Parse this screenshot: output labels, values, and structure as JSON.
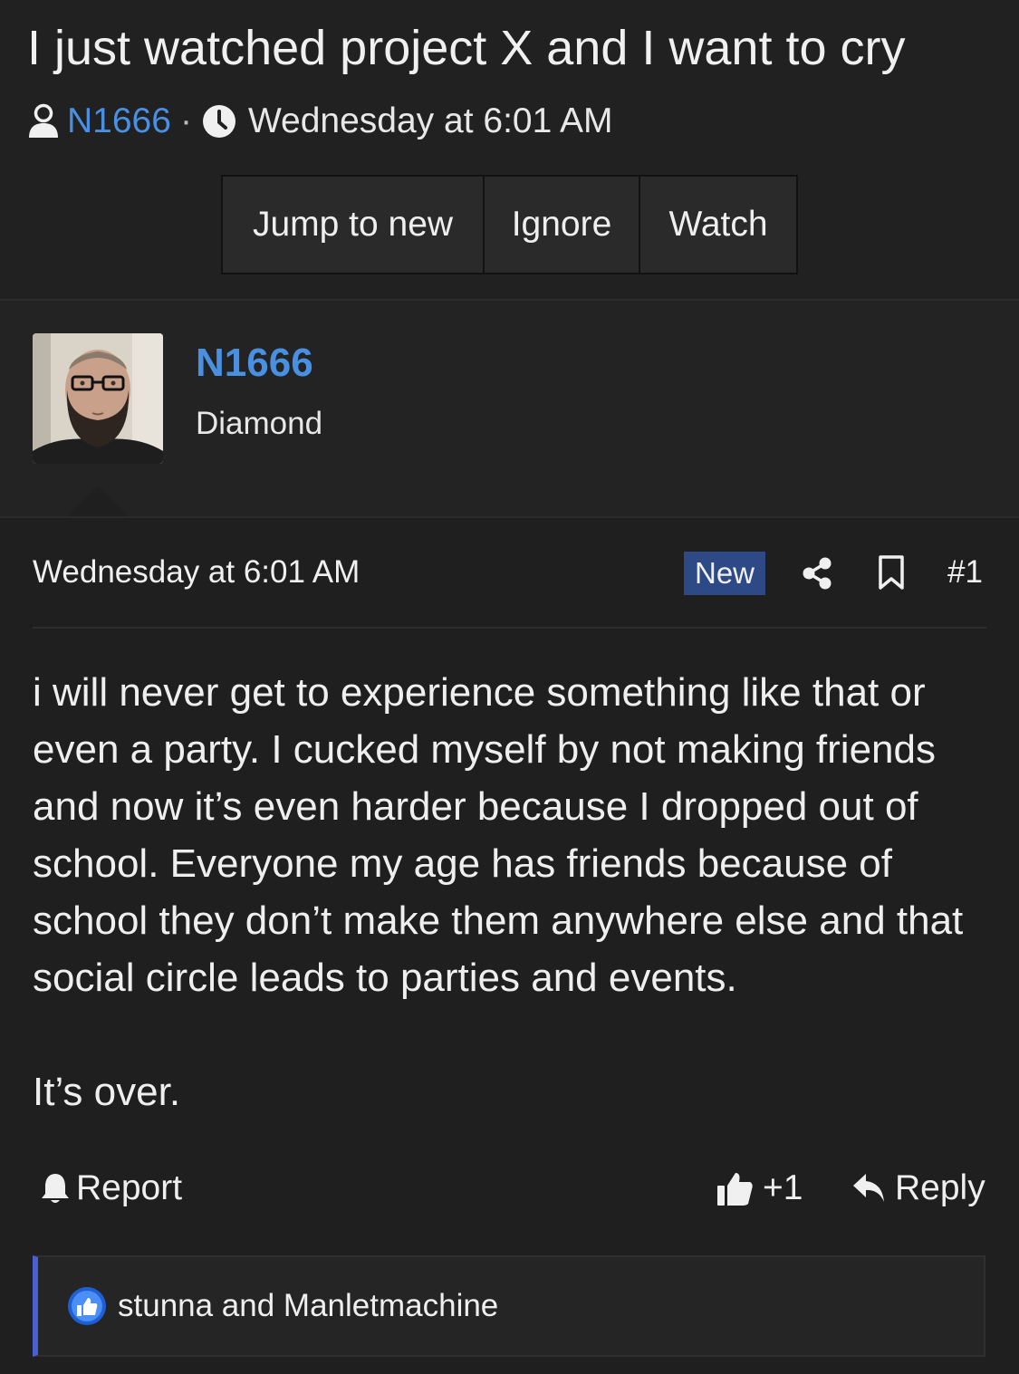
{
  "thread": {
    "title": "I just watched project X and I want to cry",
    "author": "N1666",
    "separator": "·",
    "timestamp": "Wednesday at 6:01 AM"
  },
  "actions": {
    "jump_label": "Jump to new",
    "ignore_label": "Ignore",
    "watch_label": "Watch"
  },
  "user": {
    "name": "N1666",
    "title": "Diamond"
  },
  "post": {
    "date": "Wednesday at 6:01 AM",
    "badge": "New",
    "number": "#1",
    "paragraphs": [
      "i will never get to experience something like that or even a party. I cucked myself by not making friends and now it’s even harder because I dropped out of school. Everyone my age has friends because of school they don’t make them anywhere else and that social circle leads to parties and events.",
      "It’s over."
    ],
    "report_label": "Report",
    "like_label": "+1",
    "reply_label": "Reply"
  },
  "reactions": {
    "text": "stunna and Manletmachine"
  },
  "colors": {
    "background": "#1f1f20",
    "link": "#4a90e2",
    "badge": "#2d4a86",
    "reaction_accent": "#4a5fd0"
  },
  "icons": [
    "user-icon",
    "clock-icon",
    "share-icon",
    "bookmark-icon",
    "bell-icon",
    "thumbs-up-icon",
    "reply-icon",
    "like-reaction-icon"
  ]
}
